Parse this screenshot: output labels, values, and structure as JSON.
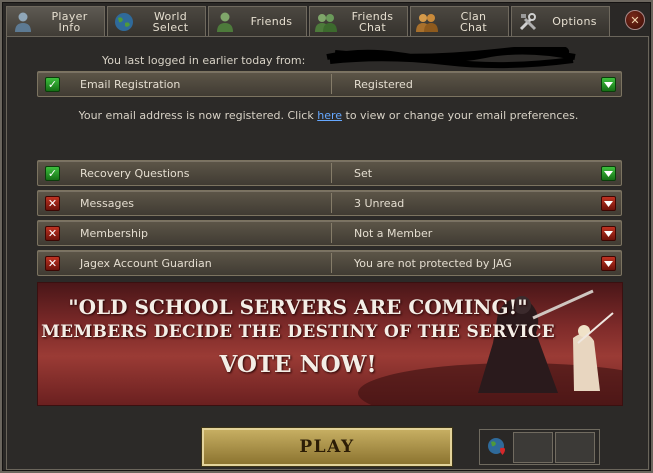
{
  "tabs": [
    {
      "label": "Player\nInfo",
      "icon": "player-icon",
      "active": true
    },
    {
      "label": "World\nSelect",
      "icon": "globe-icon",
      "active": false
    },
    {
      "label": "Friends",
      "icon": "friends-icon",
      "active": false
    },
    {
      "label": "Friends\nChat",
      "icon": "friends-chat-icon",
      "active": false
    },
    {
      "label": "Clan\nChat",
      "icon": "clan-chat-icon",
      "active": false
    },
    {
      "label": "Options",
      "icon": "tools-icon",
      "active": false
    }
  ],
  "close_label": "✕",
  "last_login_text": "You last logged in earlier today from:",
  "rows": {
    "email": {
      "label": "Email Registration",
      "value": "Registered",
      "status": "ok"
    },
    "recovery": {
      "label": "Recovery Questions",
      "value": "Set",
      "status": "ok"
    },
    "messages": {
      "label": "Messages",
      "value": "3 Unread",
      "status": "bad"
    },
    "membership": {
      "label": "Membership",
      "value": "Not a Member",
      "status": "bad"
    },
    "guardian": {
      "label": "Jagex Account Guardian",
      "value": "You are not protected by JAG",
      "status": "bad"
    }
  },
  "email_info": {
    "before": "Your email address is now registered. Click ",
    "link": "here",
    "after": " to view or change your email preferences."
  },
  "banner": {
    "line1": "\"OLD SCHOOL SERVERS ARE COMING!\"",
    "line2": "MEMBERS DECIDE THE DESTINY OF THE SERVICE",
    "line3": "VOTE NOW!"
  },
  "play_label": "PLAY",
  "colors": {
    "ok": "#2a9a2a",
    "bad": "#a82416",
    "link": "#66a8ff",
    "play_gold": "#b89b4c"
  }
}
